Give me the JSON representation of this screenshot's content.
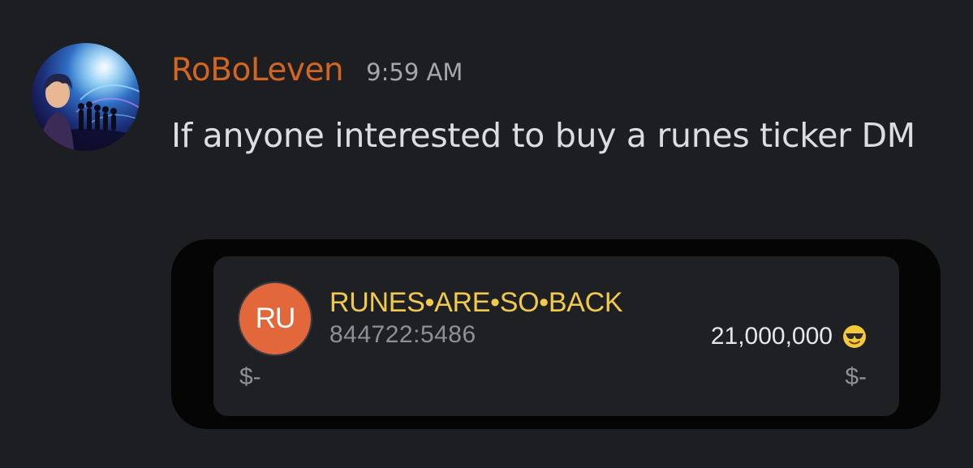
{
  "message": {
    "author": "RoBoLeven",
    "timestamp": "9:59 AM",
    "text": "If anyone interested to buy a runes ticker DM",
    "author_color": "#d2661f"
  },
  "embed": {
    "badge_text": "RU",
    "badge_color": "#e2673a",
    "rune_name": "RUNES•ARE•SO•BACK",
    "rune_id": "844722:5486",
    "supply": "21,000,000",
    "supply_emoji": "smiling-face-with-sunglasses-icon",
    "price_left": "$-",
    "price_right": "$-",
    "name_color": "#f1c94c"
  }
}
